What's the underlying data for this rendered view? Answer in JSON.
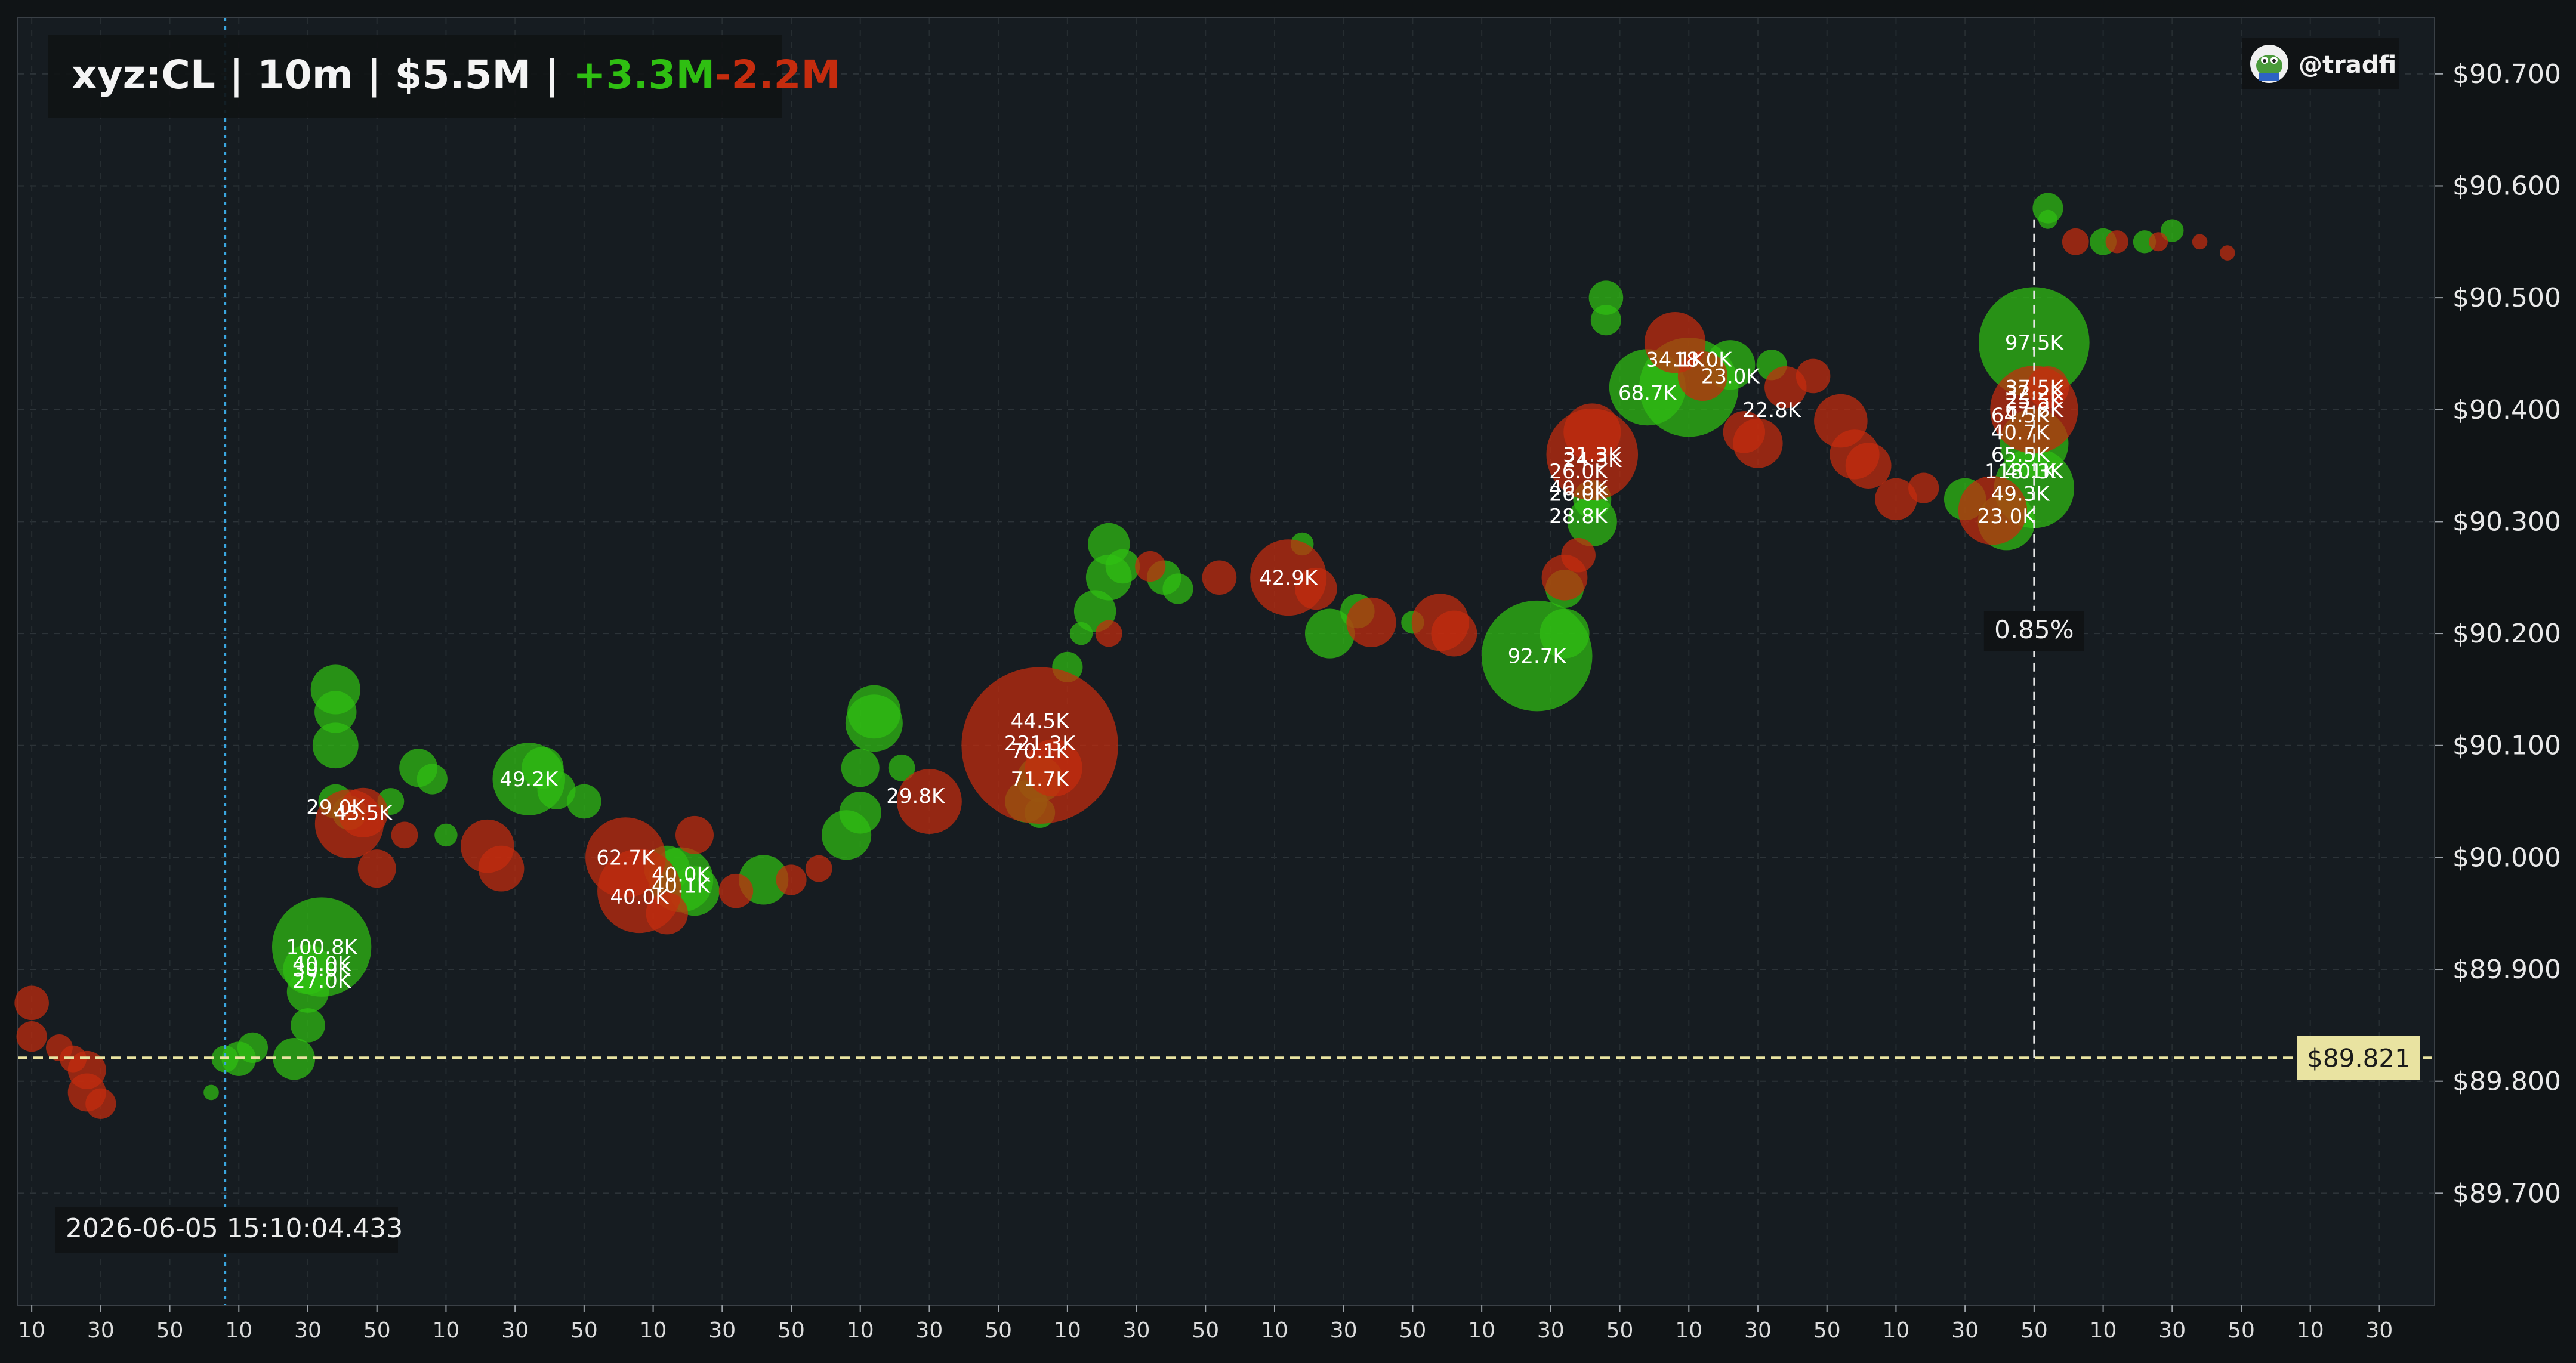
{
  "header": {
    "symbol": "xyz:CL",
    "interval": "10m",
    "total": "$5.5M",
    "buy": "+3.3M",
    "sell": "-2.2M",
    "separator": " | "
  },
  "watermark": {
    "handle": "@tradfi",
    "avatar_icon": "frog-avatar-icon"
  },
  "cursor": {
    "timestamp": "2026-06-05 15:10:04.433",
    "price_label": "$89.821",
    "price": 89.821,
    "change_label": "0.85%"
  },
  "colors": {
    "background": "#101416",
    "plot": "#161c21",
    "buy": "#2fbf12",
    "sell": "#c52c0e",
    "crosshair": "#3aa6e0",
    "price_line": "#e9e3a1"
  },
  "chart_data": {
    "type": "scatter",
    "title": "xyz:CL | 10m | $5.5M | +3.3M-2.2M",
    "ylim": [
      89.6,
      90.75
    ],
    "xlim": [
      0,
      175
    ],
    "yticks": [
      89.7,
      89.8,
      89.9,
      90.0,
      90.1,
      90.2,
      90.3,
      90.4,
      90.5,
      90.6,
      90.7
    ],
    "ytick_labels": [
      "$89.700",
      "$89.800",
      "$89.900",
      "$90.000",
      "$90.100",
      "$90.200",
      "$90.300",
      "$90.400",
      "$90.500",
      "$90.600",
      "$90.700"
    ],
    "xticks": [
      1,
      6,
      11,
      16,
      21,
      26,
      31,
      36,
      41,
      46,
      51,
      56,
      61,
      66,
      71,
      76,
      81,
      86,
      91,
      96,
      101,
      106,
      111,
      116,
      121,
      126,
      131,
      136,
      141,
      146,
      151,
      156,
      161,
      166,
      171
    ],
    "xtick_labels": [
      "10",
      "30",
      "50",
      "10",
      "30",
      "50",
      "10",
      "30",
      "50",
      "10",
      "30",
      "50",
      "10",
      "30",
      "50",
      "10",
      "30",
      "50",
      "10",
      "30",
      "50",
      "10",
      "30",
      "50",
      "10",
      "30",
      "50",
      "10",
      "30",
      "50",
      "10",
      "30",
      "50",
      "10",
      "30"
    ],
    "grid": true,
    "crosshair_x": 15,
    "price_line_y": 89.821,
    "marker_x": 146,
    "series": [
      {
        "name": "buy",
        "points": [
          [
            15,
            89.82,
            14
          ],
          [
            16,
            89.82,
            18
          ],
          [
            17,
            89.83,
            16
          ],
          [
            20,
            89.82,
            22
          ],
          [
            14,
            89.79,
            8
          ],
          [
            21,
            89.85,
            18
          ],
          [
            21,
            89.9,
            26
          ],
          [
            22,
            89.92,
            52
          ],
          [
            21,
            89.88,
            22
          ],
          [
            23,
            90.05,
            18
          ],
          [
            23,
            90.1,
            24
          ],
          [
            23,
            90.13,
            22
          ],
          [
            23,
            90.15,
            26
          ],
          [
            24,
            90.04,
            18
          ],
          [
            27,
            90.05,
            14
          ],
          [
            29,
            90.08,
            20
          ],
          [
            30,
            90.07,
            16
          ],
          [
            31,
            90.02,
            12
          ],
          [
            37,
            90.07,
            38
          ],
          [
            38,
            90.08,
            22
          ],
          [
            39,
            90.06,
            20
          ],
          [
            41,
            90.05,
            18
          ],
          [
            47,
            89.99,
            24
          ],
          [
            48,
            89.98,
            34
          ],
          [
            49,
            89.97,
            26
          ],
          [
            54,
            89.98,
            26
          ],
          [
            60,
            90.02,
            26
          ],
          [
            61,
            90.04,
            22
          ],
          [
            61,
            90.08,
            20
          ],
          [
            62,
            90.12,
            30
          ],
          [
            62,
            90.13,
            28
          ],
          [
            64,
            90.08,
            14
          ],
          [
            73,
            90.05,
            22
          ],
          [
            74,
            90.04,
            16
          ],
          [
            74,
            90.07,
            24
          ],
          [
            76,
            90.17,
            16
          ],
          [
            77,
            90.2,
            12
          ],
          [
            78,
            90.22,
            22
          ],
          [
            79,
            90.25,
            24
          ],
          [
            79,
            90.28,
            22
          ],
          [
            80,
            90.26,
            18
          ],
          [
            83,
            90.25,
            18
          ],
          [
            84,
            90.24,
            16
          ],
          [
            93,
            90.28,
            12
          ],
          [
            95,
            90.2,
            26
          ],
          [
            97,
            90.22,
            18
          ],
          [
            101,
            90.21,
            12
          ],
          [
            110,
            90.18,
            58
          ],
          [
            112,
            90.2,
            26
          ],
          [
            112,
            90.24,
            20
          ],
          [
            114,
            90.3,
            26
          ],
          [
            114,
            90.32,
            20
          ],
          [
            115,
            90.48,
            16
          ],
          [
            115,
            90.5,
            18
          ],
          [
            118,
            90.42,
            40
          ],
          [
            121,
            90.42,
            52
          ],
          [
            124,
            90.44,
            26
          ],
          [
            127,
            90.44,
            16
          ],
          [
            141,
            90.32,
            22
          ],
          [
            144,
            90.3,
            30
          ],
          [
            146,
            90.33,
            42
          ],
          [
            146,
            90.37,
            36
          ],
          [
            146,
            90.46,
            58
          ],
          [
            147,
            90.58,
            16
          ],
          [
            151,
            90.55,
            14
          ],
          [
            154,
            90.55,
            12
          ],
          [
            156,
            90.56,
            12
          ],
          [
            147,
            90.57,
            10
          ]
        ]
      },
      {
        "name": "sell",
        "points": [
          [
            1,
            89.87,
            18
          ],
          [
            1,
            89.84,
            16
          ],
          [
            3,
            89.83,
            14
          ],
          [
            4,
            89.82,
            14
          ],
          [
            5,
            89.81,
            20
          ],
          [
            5,
            89.79,
            20
          ],
          [
            6,
            89.78,
            16
          ],
          [
            24,
            90.03,
            36
          ],
          [
            25,
            90.04,
            26
          ],
          [
            26,
            89.99,
            20
          ],
          [
            28,
            90.02,
            14
          ],
          [
            34,
            90.01,
            28
          ],
          [
            35,
            89.99,
            24
          ],
          [
            44,
            90.0,
            42
          ],
          [
            45,
            89.97,
            44
          ],
          [
            47,
            89.95,
            22
          ],
          [
            49,
            90.02,
            20
          ],
          [
            52,
            89.97,
            18
          ],
          [
            56,
            89.98,
            16
          ],
          [
            58,
            89.99,
            14
          ],
          [
            66,
            90.05,
            34
          ],
          [
            74,
            90.1,
            82
          ],
          [
            75,
            90.08,
            30
          ],
          [
            79,
            90.2,
            14
          ],
          [
            82,
            90.26,
            16
          ],
          [
            87,
            90.25,
            18
          ],
          [
            92,
            90.25,
            40
          ],
          [
            94,
            90.24,
            22
          ],
          [
            98,
            90.21,
            26
          ],
          [
            103,
            90.21,
            30
          ],
          [
            104,
            90.2,
            24
          ],
          [
            112,
            90.25,
            24
          ],
          [
            113,
            90.27,
            18
          ],
          [
            114,
            90.36,
            48
          ],
          [
            114,
            90.38,
            30
          ],
          [
            120,
            90.46,
            32
          ],
          [
            122,
            90.43,
            26
          ],
          [
            125,
            90.38,
            22
          ],
          [
            126,
            90.37,
            26
          ],
          [
            128,
            90.42,
            22
          ],
          [
            130,
            90.43,
            18
          ],
          [
            132,
            90.39,
            28
          ],
          [
            133,
            90.36,
            26
          ],
          [
            134,
            90.35,
            24
          ],
          [
            136,
            90.32,
            22
          ],
          [
            138,
            90.33,
            16
          ],
          [
            143,
            90.31,
            36
          ],
          [
            146,
            90.4,
            46
          ],
          [
            147,
            90.42,
            22
          ],
          [
            149,
            90.55,
            14
          ],
          [
            152,
            90.55,
            12
          ],
          [
            155,
            90.55,
            10
          ],
          [
            158,
            90.55,
            8
          ],
          [
            160,
            90.54,
            8
          ]
        ]
      }
    ],
    "labels": [
      {
        "x": 22,
        "y": 89.92,
        "text": "100.8K"
      },
      {
        "x": 22,
        "y": 89.905,
        "text": "40.0K"
      },
      {
        "x": 22,
        "y": 89.9,
        "text": "30.0K"
      },
      {
        "x": 22,
        "y": 89.89,
        "text": "27.0K"
      },
      {
        "x": 23,
        "y": 90.045,
        "text": "29.0K"
      },
      {
        "x": 25,
        "y": 90.04,
        "text": "45.5K"
      },
      {
        "x": 37,
        "y": 90.07,
        "text": "49.2K"
      },
      {
        "x": 44,
        "y": 90.0,
        "text": "62.7K"
      },
      {
        "x": 45,
        "y": 89.965,
        "text": "40.0K"
      },
      {
        "x": 48,
        "y": 89.985,
        "text": "40.0K"
      },
      {
        "x": 48,
        "y": 89.975,
        "text": "40.1K"
      },
      {
        "x": 65,
        "y": 90.055,
        "text": "29.8K"
      },
      {
        "x": 74,
        "y": 90.122,
        "text": "44.5K"
      },
      {
        "x": 74,
        "y": 90.102,
        "text": "221.3K"
      },
      {
        "x": 74,
        "y": 90.095,
        "text": "70.1K"
      },
      {
        "x": 74,
        "y": 90.07,
        "text": "71.7K"
      },
      {
        "x": 92,
        "y": 90.25,
        "text": "42.9K"
      },
      {
        "x": 110,
        "y": 90.18,
        "text": "92.7K"
      },
      {
        "x": 114,
        "y": 90.36,
        "text": "31.3K"
      },
      {
        "x": 114,
        "y": 90.355,
        "text": "24.3K"
      },
      {
        "x": 113,
        "y": 90.345,
        "text": "26.0K"
      },
      {
        "x": 113,
        "y": 90.33,
        "text": "40.8K"
      },
      {
        "x": 113,
        "y": 90.325,
        "text": "26.0K"
      },
      {
        "x": 113,
        "y": 90.305,
        "text": "28.8K"
      },
      {
        "x": 118,
        "y": 90.415,
        "text": "68.7K"
      },
      {
        "x": 120,
        "y": 90.445,
        "text": "34.1K"
      },
      {
        "x": 122,
        "y": 90.445,
        "text": "18.0K"
      },
      {
        "x": 124,
        "y": 90.43,
        "text": "23.0K"
      },
      {
        "x": 127,
        "y": 90.4,
        "text": "22.8K"
      },
      {
        "x": 146,
        "y": 90.46,
        "text": "97.5K"
      },
      {
        "x": 146,
        "y": 90.42,
        "text": "37.5K"
      },
      {
        "x": 146,
        "y": 90.415,
        "text": "32.2K"
      },
      {
        "x": 146,
        "y": 90.408,
        "text": "25.5K"
      },
      {
        "x": 146,
        "y": 90.4,
        "text": "67.8K"
      },
      {
        "x": 145,
        "y": 90.395,
        "text": "64.5K"
      },
      {
        "x": 145,
        "y": 90.38,
        "text": "40.7K"
      },
      {
        "x": 145,
        "y": 90.36,
        "text": "65.5K"
      },
      {
        "x": 145,
        "y": 90.345,
        "text": "118.1K"
      },
      {
        "x": 146,
        "y": 90.345,
        "text": "40.3K"
      },
      {
        "x": 145,
        "y": 90.325,
        "text": "49.3K"
      },
      {
        "x": 144,
        "y": 90.305,
        "text": "23.0K"
      }
    ]
  }
}
